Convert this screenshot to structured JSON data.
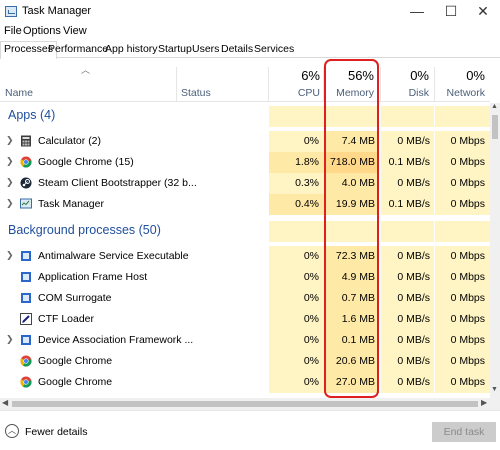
{
  "window": {
    "title": "Task Manager",
    "minimize": "—",
    "maximize": "☐",
    "close": "✕"
  },
  "menu": [
    "File",
    "Options",
    "View"
  ],
  "tabs": [
    "Processes",
    "Performance",
    "App history",
    "Startup",
    "Users",
    "Details",
    "Services"
  ],
  "header": {
    "name": "Name",
    "status": "Status",
    "cpu_pct": "6%",
    "cpu": "CPU",
    "memory_pct": "56%",
    "memory": "Memory",
    "disk_pct": "0%",
    "disk": "Disk",
    "network_pct": "0%",
    "network": "Network"
  },
  "groups": {
    "apps": "Apps (4)",
    "background": "Background processes (50)"
  },
  "apps": [
    {
      "name": "Calculator (2)",
      "icon": "calculator-icon",
      "expandable": true,
      "cpu": "0%",
      "memory": "7.4 MB",
      "disk": "0 MB/s",
      "network": "0 Mbps"
    },
    {
      "name": "Google Chrome (15)",
      "icon": "chrome-icon",
      "expandable": true,
      "cpu": "1.8%",
      "memory": "718.0 MB",
      "disk": "0.1 MB/s",
      "network": "0 Mbps"
    },
    {
      "name": "Steam Client Bootstrapper (32 b...",
      "icon": "steam-icon",
      "expandable": true,
      "cpu": "0.3%",
      "memory": "4.0 MB",
      "disk": "0 MB/s",
      "network": "0 Mbps"
    },
    {
      "name": "Task Manager",
      "icon": "task-manager-icon",
      "expandable": true,
      "cpu": "0.4%",
      "memory": "19.9 MB",
      "disk": "0.1 MB/s",
      "network": "0 Mbps"
    }
  ],
  "background": [
    {
      "name": "Antimalware Service Executable",
      "icon": "service-icon",
      "expandable": true,
      "cpu": "0%",
      "memory": "72.3 MB",
      "disk": "0 MB/s",
      "network": "0 Mbps"
    },
    {
      "name": "Application Frame Host",
      "icon": "service-icon",
      "expandable": false,
      "cpu": "0%",
      "memory": "4.9 MB",
      "disk": "0 MB/s",
      "network": "0 Mbps"
    },
    {
      "name": "COM Surrogate",
      "icon": "service-icon",
      "expandable": false,
      "cpu": "0%",
      "memory": "0.7 MB",
      "disk": "0 MB/s",
      "network": "0 Mbps"
    },
    {
      "name": "CTF Loader",
      "icon": "pen-icon",
      "expandable": false,
      "cpu": "0%",
      "memory": "1.6 MB",
      "disk": "0 MB/s",
      "network": "0 Mbps"
    },
    {
      "name": "Device Association Framework ...",
      "icon": "service-icon",
      "expandable": true,
      "cpu": "0%",
      "memory": "0.1 MB",
      "disk": "0 MB/s",
      "network": "0 Mbps"
    },
    {
      "name": "Google Chrome",
      "icon": "chrome-icon",
      "expandable": false,
      "cpu": "0%",
      "memory": "20.6 MB",
      "disk": "0 MB/s",
      "network": "0 Mbps"
    },
    {
      "name": "Google Chrome",
      "icon": "chrome-icon",
      "expandable": false,
      "cpu": "0%",
      "memory": "27.0 MB",
      "disk": "0 MB/s",
      "network": "0 Mbps"
    }
  ],
  "footer": {
    "fewer_details": "Fewer details",
    "end_task": "End task"
  },
  "colors": {
    "heat_light": "#fff4c4",
    "heat_mid": "#ffe9a6",
    "heat_strong": "#ffd88a",
    "highlight": "#e02020",
    "group_text": "#1f4e9c"
  }
}
